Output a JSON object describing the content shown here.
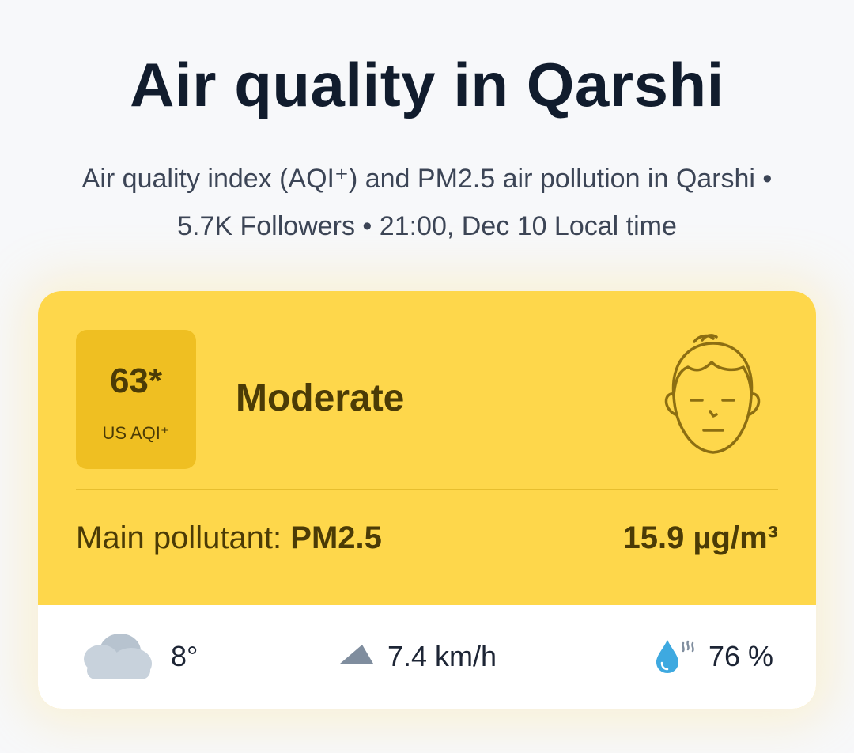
{
  "header": {
    "title": "Air quality in Qarshi",
    "subtitle_line1": "Air quality index (AQI⁺) and PM2.5 air pollution in Qarshi •",
    "subtitle_line2": "5.7K Followers • 21:00, Dec 10 Local time"
  },
  "aqi_card": {
    "value": "63*",
    "unit": "US AQI⁺",
    "status": "Moderate",
    "face_icon": "neutral-face-icon",
    "pollutant_label": "Main pollutant: ",
    "pollutant_name": "PM2.5",
    "concentration": "15.9 µg/m³",
    "colors": {
      "card_bg": "#fed74b",
      "aqi_box_bg": "#efbf22",
      "text": "#4b3b06"
    }
  },
  "weather": {
    "temperature": "8°",
    "temperature_icon": "cloud-icon",
    "wind": "7.4 km/h",
    "wind_icon": "wind-direction-icon",
    "humidity": "76 %",
    "humidity_icon": "humidity-drop-icon"
  }
}
